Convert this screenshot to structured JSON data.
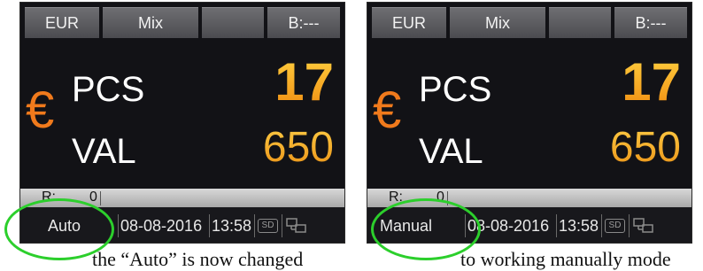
{
  "screens": [
    {
      "tabs": [
        "EUR",
        "Mix",
        "",
        "B:---"
      ],
      "currency_symbol": "€",
      "pcs_label": "PCS",
      "pcs_value": "17",
      "val_label": "VAL",
      "val_value": "650",
      "r_label": "R:",
      "r_value": "0",
      "mode": "Auto",
      "date": "08-08-2016",
      "time": "13:58",
      "sd_label": "SD"
    },
    {
      "tabs": [
        "EUR",
        "Mix",
        "",
        "B:---"
      ],
      "currency_symbol": "€",
      "pcs_label": "PCS",
      "pcs_value": "17",
      "val_label": "VAL",
      "val_value": "650",
      "r_label": "R:",
      "r_value": "0",
      "mode": "Manual",
      "date": "08-08-2016",
      "time": "13:58",
      "sd_label": "SD"
    }
  ],
  "colors": {
    "highlight_circle": "#2ccf2c",
    "currency_accent": "#f07a1c",
    "screen_bg": "#121216"
  },
  "icons": [
    "sd-card-icon",
    "network-icon"
  ],
  "caption": {
    "part1": "the “Auto” is now changed",
    "part2": "to working manually mode"
  }
}
